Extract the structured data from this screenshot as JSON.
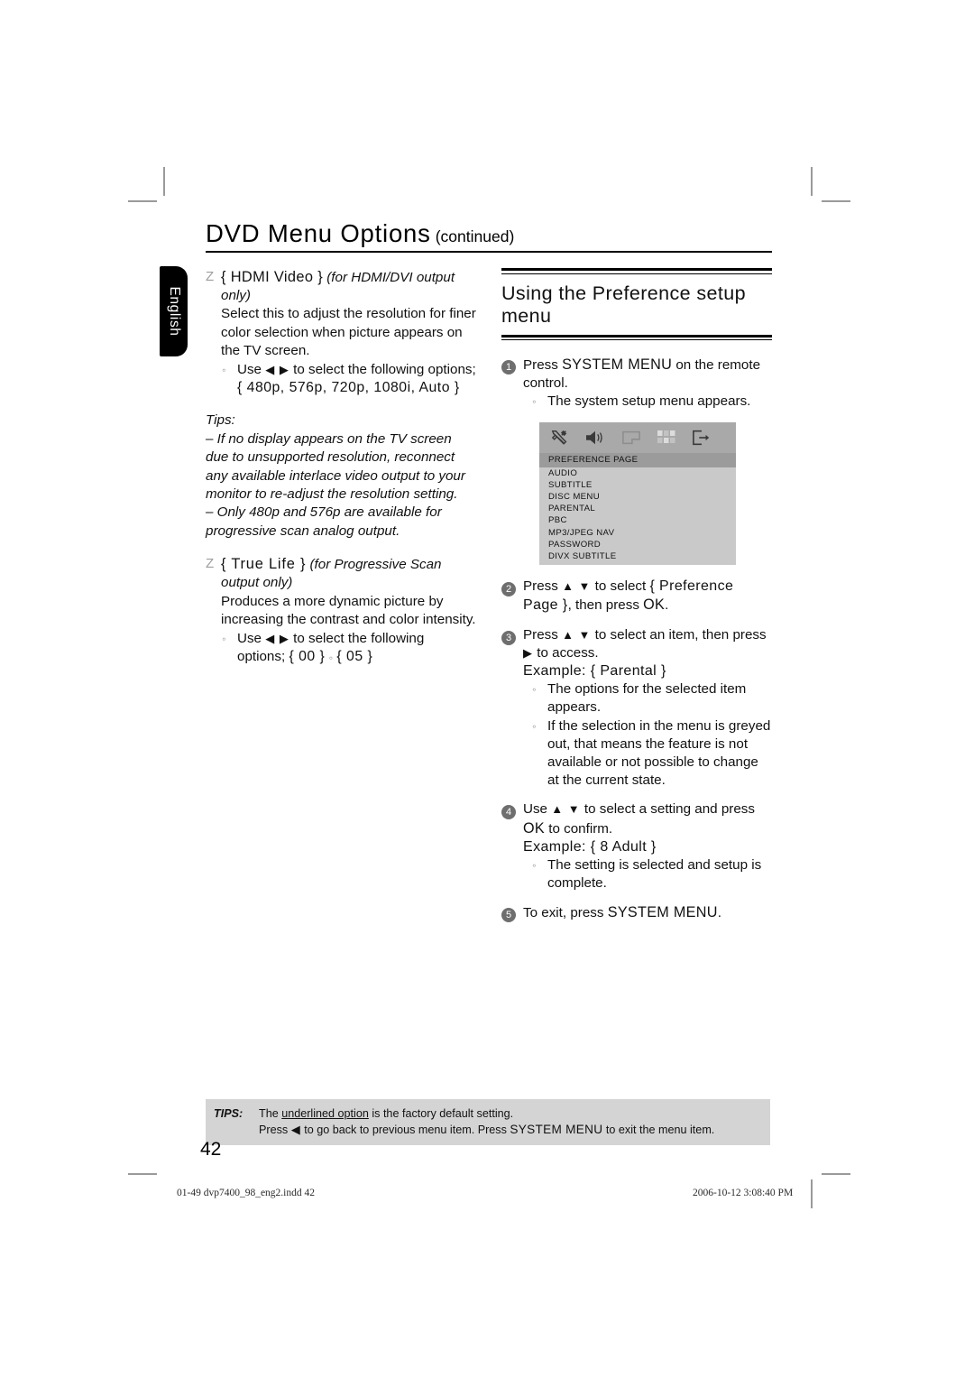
{
  "header": {
    "title": "DVD Menu Options",
    "title_suffix": "(continued)"
  },
  "language_tab": {
    "label": "English"
  },
  "left_column": {
    "items": [
      {
        "marker": "Z",
        "heading": "{ HDMI Video }",
        "heading_note": "(for HDMI/DVI output only)",
        "paragraph": "Select this to adjust the resolution for finer color selection when picture appears on the TV screen.",
        "sub_bullet_marker": "⸰",
        "sub_bullet_text_prefix": "Use",
        "sub_bullet_arrows": "◀ ▶",
        "sub_bullet_text_suffix": "to select the following options;",
        "options_line": "{ 480p, 576p, 720p, 1080i, Auto }"
      },
      {
        "marker": "Z",
        "heading": "{ True Life }",
        "heading_note": "(for Progressive Scan output only)",
        "paragraph": "Produces a more dynamic picture by increasing the contrast and color intensity.",
        "sub_bullet_marker": "⸰",
        "sub_bullet_text_prefix": "Use",
        "sub_bullet_arrows": "◀ ▶",
        "sub_bullet_text_suffix": "to select the following",
        "options_label": "options;",
        "options_first": "{ 00 }",
        "options_separator": "⸰",
        "options_last": "{ 05 }"
      }
    ],
    "tips": {
      "label": "Tips:",
      "lines": [
        "– If no display appears on the TV screen due to unsupported resolution, reconnect any available interlace video output to your monitor to re-adjust the resolution setting.",
        "– Only 480p and 576p are available for progressive scan analog output."
      ]
    }
  },
  "right_column": {
    "section_title": "Using the Preference setup menu",
    "steps": [
      {
        "num": "1",
        "text_a": "Press",
        "caps": "SYSTEM MENU",
        "text_b": "on the remote control.",
        "sub_marker": "⸰",
        "sub_text": "The system setup menu appears."
      },
      {
        "num": "2",
        "text_a": "Press",
        "arrows": "▲ ▼",
        "text_b": "to select",
        "curly": "{ Preference Page }",
        "text_c": ", then press",
        "caps": "OK",
        "text_d": "."
      },
      {
        "num": "3",
        "text_a": "Press",
        "arrows": "▲ ▼",
        "text_b": "to select an item, then press",
        "arrow2": "▶",
        "text_c": "to access.",
        "example": "Example: { Parental }",
        "subs": [
          {
            "marker": "⸰",
            "text": "The options for the selected item appears."
          },
          {
            "marker": "⸰",
            "text": "If the selection in the menu is greyed out, that means the feature is not available or not possible to change at the current state."
          }
        ]
      },
      {
        "num": "4",
        "text_a": "Use",
        "arrows": "▲ ▼",
        "text_b": "to select a setting and press",
        "caps": "OK",
        "text_c": "to confirm.",
        "example": "Example: { 8 Adult }",
        "subs": [
          {
            "marker": "⸰",
            "text": "The setting is selected and setup is complete."
          }
        ]
      },
      {
        "num": "5",
        "text_a": "To exit, press",
        "caps": "SYSTEM MENU",
        "text_b": "."
      }
    ],
    "osd": {
      "icons": [
        "tools-icon",
        "speaker-icon",
        "screen-icon",
        "grid-icon",
        "exit-icon"
      ],
      "rows": [
        {
          "label": "PREFERENCE PAGE",
          "selected": true
        },
        {
          "label": "AUDIO",
          "selected": false
        },
        {
          "label": "SUBTITLE",
          "selected": false
        },
        {
          "label": "DISC MENU",
          "selected": false
        },
        {
          "label": "PARENTAL",
          "selected": false
        },
        {
          "label": "PBC",
          "selected": false
        },
        {
          "label": "MP3/JPEG NAV",
          "selected": false
        },
        {
          "label": "PASSWORD",
          "selected": false
        },
        {
          "label": "DIVX SUBTITLE",
          "selected": false
        }
      ],
      "colors": {
        "icon_bar": "#a9a9a9",
        "list_bg": "#c9c9c9",
        "selected_row": "#9b9b9b"
      }
    }
  },
  "footer": {
    "tips_label": "TIPS:",
    "tips_line1_a": "The",
    "tips_line1_u": "underlined option",
    "tips_line1_b": "is the factory default setting.",
    "tips_line2_a": "Press",
    "tips_line2_arrow": "◀",
    "tips_line2_b": "to go back to previous menu item. Press",
    "tips_line2_caps": "SYSTEM MENU",
    "tips_line2_c": "to exit the menu item.",
    "page_number": "42",
    "print_file": "01-49 dvp7400_98_eng2.indd   42",
    "print_timestamp": "2006-10-12   3:08:40 PM"
  }
}
